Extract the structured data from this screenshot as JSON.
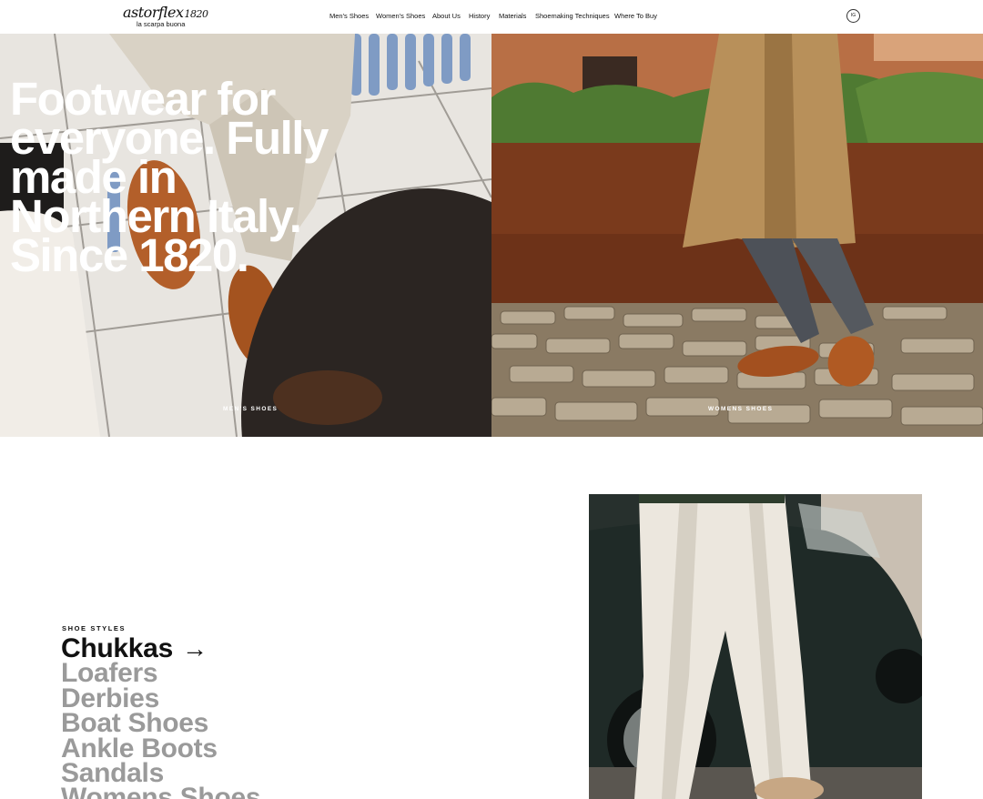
{
  "brand": {
    "name": "astorflex",
    "year": "1820",
    "tagline": "la scarpa buona"
  },
  "nav": {
    "items": [
      {
        "label": "Men's Shoes"
      },
      {
        "label": "Women's Shoes"
      },
      {
        "label": "About Us"
      },
      {
        "label": "History"
      },
      {
        "label": "Materials"
      },
      {
        "label": "Shoemaking Techniques"
      },
      {
        "label": "Where To Buy"
      }
    ],
    "instagram_label": "IG"
  },
  "hero": {
    "headline": "Footwear for everyone. Fully made in Northern Italy. Since 1820.",
    "left_label": "MEN'S SHOES",
    "right_label": "WOMENS SHOES"
  },
  "styles": {
    "heading": "SHOE STYLES",
    "arrow": "→",
    "items": [
      {
        "label": "Chukkas"
      },
      {
        "label": "Loafers"
      },
      {
        "label": "Derbies"
      },
      {
        "label": "Boat Shoes"
      },
      {
        "label": "Ankle Boots"
      },
      {
        "label": "Sandals"
      },
      {
        "label": "Womens Shoes"
      }
    ]
  },
  "colors": {
    "accent": "#111111",
    "muted": "#9a9a9a",
    "background": "#ffffff"
  }
}
